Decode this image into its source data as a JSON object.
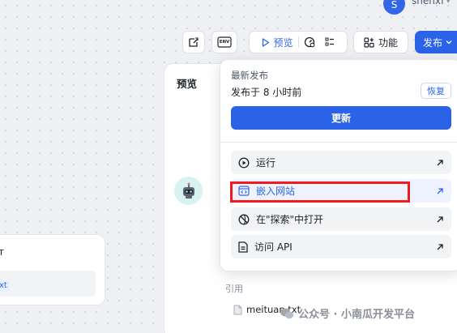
{
  "user": {
    "avatar_letter": "S",
    "name": "shenxf"
  },
  "toolbar": {
    "icon_buttons": [
      "edit-check-icon",
      "env-icon"
    ],
    "env_label": "ENV",
    "preview_label": "预览",
    "features_label": "功能",
    "publish_label": "发布"
  },
  "preview_panel": {
    "title": "预览"
  },
  "left_card": {
    "tag": "ext",
    "mark": "т"
  },
  "publish_menu": {
    "subtitle": "最新发布",
    "time": "发布于 8 小时前",
    "restore_label": "恢复",
    "update_label": "更新",
    "items": [
      {
        "label": "运行",
        "icon": "play-icon"
      },
      {
        "label": "嵌入网站",
        "icon": "embed-icon"
      },
      {
        "label": "在\"探索\"中打开",
        "icon": "explore-icon"
      },
      {
        "label": "访问 API",
        "icon": "api-doc-icon"
      }
    ]
  },
  "references": {
    "label": "引用",
    "file": "meituan.txt"
  },
  "watermark": {
    "text": "公众号 · 小南瓜开发平台"
  },
  "colors": {
    "accent": "#2b63e8",
    "highlight": "#ee1c1c"
  }
}
